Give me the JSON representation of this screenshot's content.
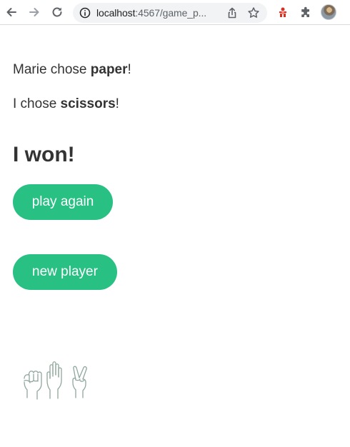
{
  "browser": {
    "url_host": "localhost",
    "url_rest": ":4567/game_p...",
    "icons": {
      "back": "arrow-left-icon",
      "forward": "arrow-right-icon",
      "reload": "reload-icon",
      "site_info": "info-icon",
      "share": "share-icon",
      "bookmark": "star-icon",
      "extension": "extension-icon",
      "extensions_menu": "puzzle-icon",
      "profile": "avatar"
    }
  },
  "game": {
    "opponent_prefix": "Marie chose ",
    "opponent_choice": "paper",
    "opponent_suffix": "!",
    "self_prefix": "I chose ",
    "self_choice": "scissors",
    "self_suffix": "!",
    "result": "I won!",
    "play_again_label": "play again",
    "new_player_label": "new player",
    "illustration": "rock-paper-scissors-hands-icon"
  },
  "colors": {
    "button_bg": "#28c083",
    "button_text": "#ffffff",
    "text": "#333333"
  }
}
